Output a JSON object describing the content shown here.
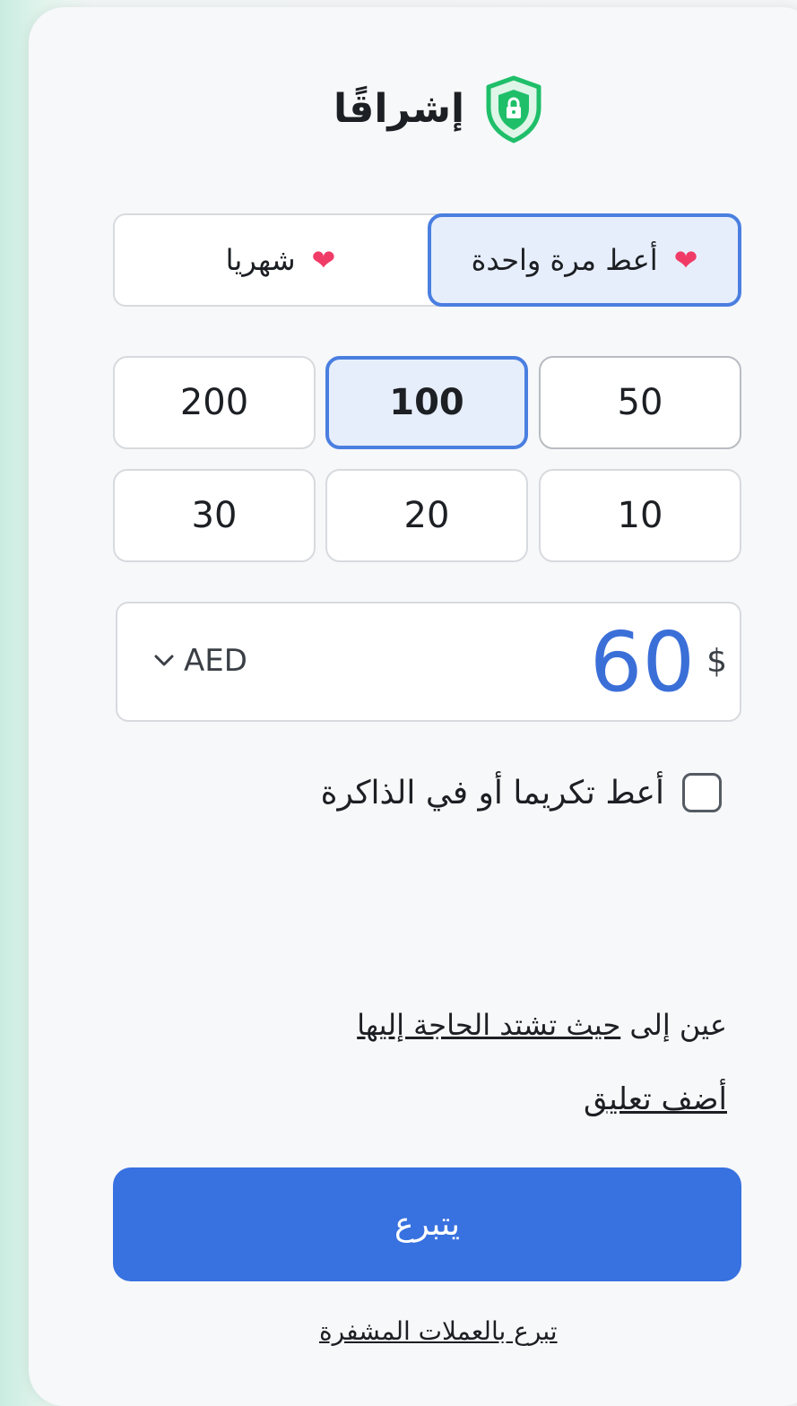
{
  "brand": {
    "name": "إشراقًا",
    "icon": "shield-lock-icon",
    "accent": "#1fbf6a"
  },
  "frequency": {
    "once_label": "أعط مرة واحدة",
    "monthly_label": "شهريا",
    "selected": "once",
    "heart_icon": "heart-icon",
    "heart": "❤"
  },
  "amounts": {
    "items": [
      "50",
      "100",
      "200",
      "10",
      "20",
      "30"
    ],
    "selected": "100"
  },
  "custom_amount": {
    "currency_symbol": "$",
    "value": "60",
    "currency_code": "AED",
    "dropdown_icon": "chevron-down-icon"
  },
  "tribute": {
    "label": "أعط تكريما أو في الذاكرة",
    "checked": false
  },
  "direct": {
    "prefix": "عين إلى",
    "link": "حيث تشتد الحاجة إليها"
  },
  "comment_link": "أضف تعليق",
  "donate_button": "يتبرع",
  "crypto_link": "تبرع بالعملات المشفرة",
  "colors": {
    "primary": "#3871e0",
    "selected_border": "#4a7fe0",
    "selected_bg": "#e7eefb",
    "heart": "#f03b67"
  }
}
